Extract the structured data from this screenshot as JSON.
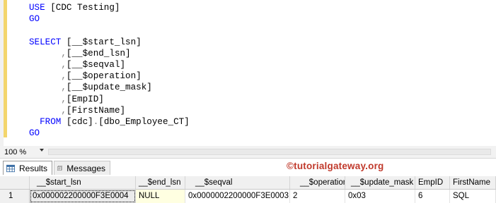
{
  "editor": {
    "lines": [
      {
        "segments": [
          {
            "text": "USE ",
            "style": "kw"
          },
          {
            "text": "[CDC Testing]",
            "style": "txt"
          }
        ]
      },
      {
        "segments": [
          {
            "text": "GO",
            "style": "kw"
          }
        ]
      },
      {
        "segments": []
      },
      {
        "segments": [
          {
            "text": "SELECT ",
            "style": "kw"
          },
          {
            "text": "[__$start_lsn]",
            "style": "txt"
          }
        ]
      },
      {
        "segments": [
          {
            "text": "      ",
            "style": "txt"
          },
          {
            "text": ",",
            "style": "gray"
          },
          {
            "text": "[__$end_lsn]",
            "style": "txt"
          }
        ]
      },
      {
        "segments": [
          {
            "text": "      ",
            "style": "txt"
          },
          {
            "text": ",",
            "style": "gray"
          },
          {
            "text": "[__$seqval]",
            "style": "txt"
          }
        ]
      },
      {
        "segments": [
          {
            "text": "      ",
            "style": "txt"
          },
          {
            "text": ",",
            "style": "gray"
          },
          {
            "text": "[__$operation]",
            "style": "txt"
          }
        ]
      },
      {
        "segments": [
          {
            "text": "      ",
            "style": "txt"
          },
          {
            "text": ",",
            "style": "gray"
          },
          {
            "text": "[__$update_mask]",
            "style": "txt"
          }
        ]
      },
      {
        "segments": [
          {
            "text": "      ",
            "style": "txt"
          },
          {
            "text": ",",
            "style": "gray"
          },
          {
            "text": "[EmpID]",
            "style": "txt"
          }
        ]
      },
      {
        "segments": [
          {
            "text": "      ",
            "style": "txt"
          },
          {
            "text": ",",
            "style": "gray"
          },
          {
            "text": "[FirstName]",
            "style": "txt"
          }
        ]
      },
      {
        "segments": [
          {
            "text": "  FROM ",
            "style": "kw"
          },
          {
            "text": "[cdc]",
            "style": "txt"
          },
          {
            "text": ".",
            "style": "gray"
          },
          {
            "text": "[dbo_Employee_CT]",
            "style": "txt"
          }
        ]
      },
      {
        "segments": [
          {
            "text": "GO",
            "style": "kw"
          }
        ]
      }
    ]
  },
  "status": {
    "zoom": "100 %"
  },
  "results": {
    "tabs": [
      {
        "label": "Results",
        "icon": "grid-icon"
      },
      {
        "label": "Messages",
        "icon": "messages-icon"
      }
    ],
    "brand": "©tutorialgateway.org",
    "columns": [
      "__$start_lsn",
      "__$end_lsn",
      "__$seqval",
      "__$operation",
      "__$update_mask",
      "EmpID",
      "FirstName"
    ],
    "rows": [
      {
        "num": "1",
        "values": [
          "0x000002200000F3E0004",
          "NULL",
          "0x0000002200000F3E0003",
          "2",
          "0x03",
          "6",
          "SQL"
        ]
      }
    ]
  },
  "colors": {
    "keyword": "#0000ff",
    "punctuation": "#808080",
    "change_bar": "#f3d56c",
    "brand": "#c0392b",
    "null_bg": "#ffffe1"
  }
}
